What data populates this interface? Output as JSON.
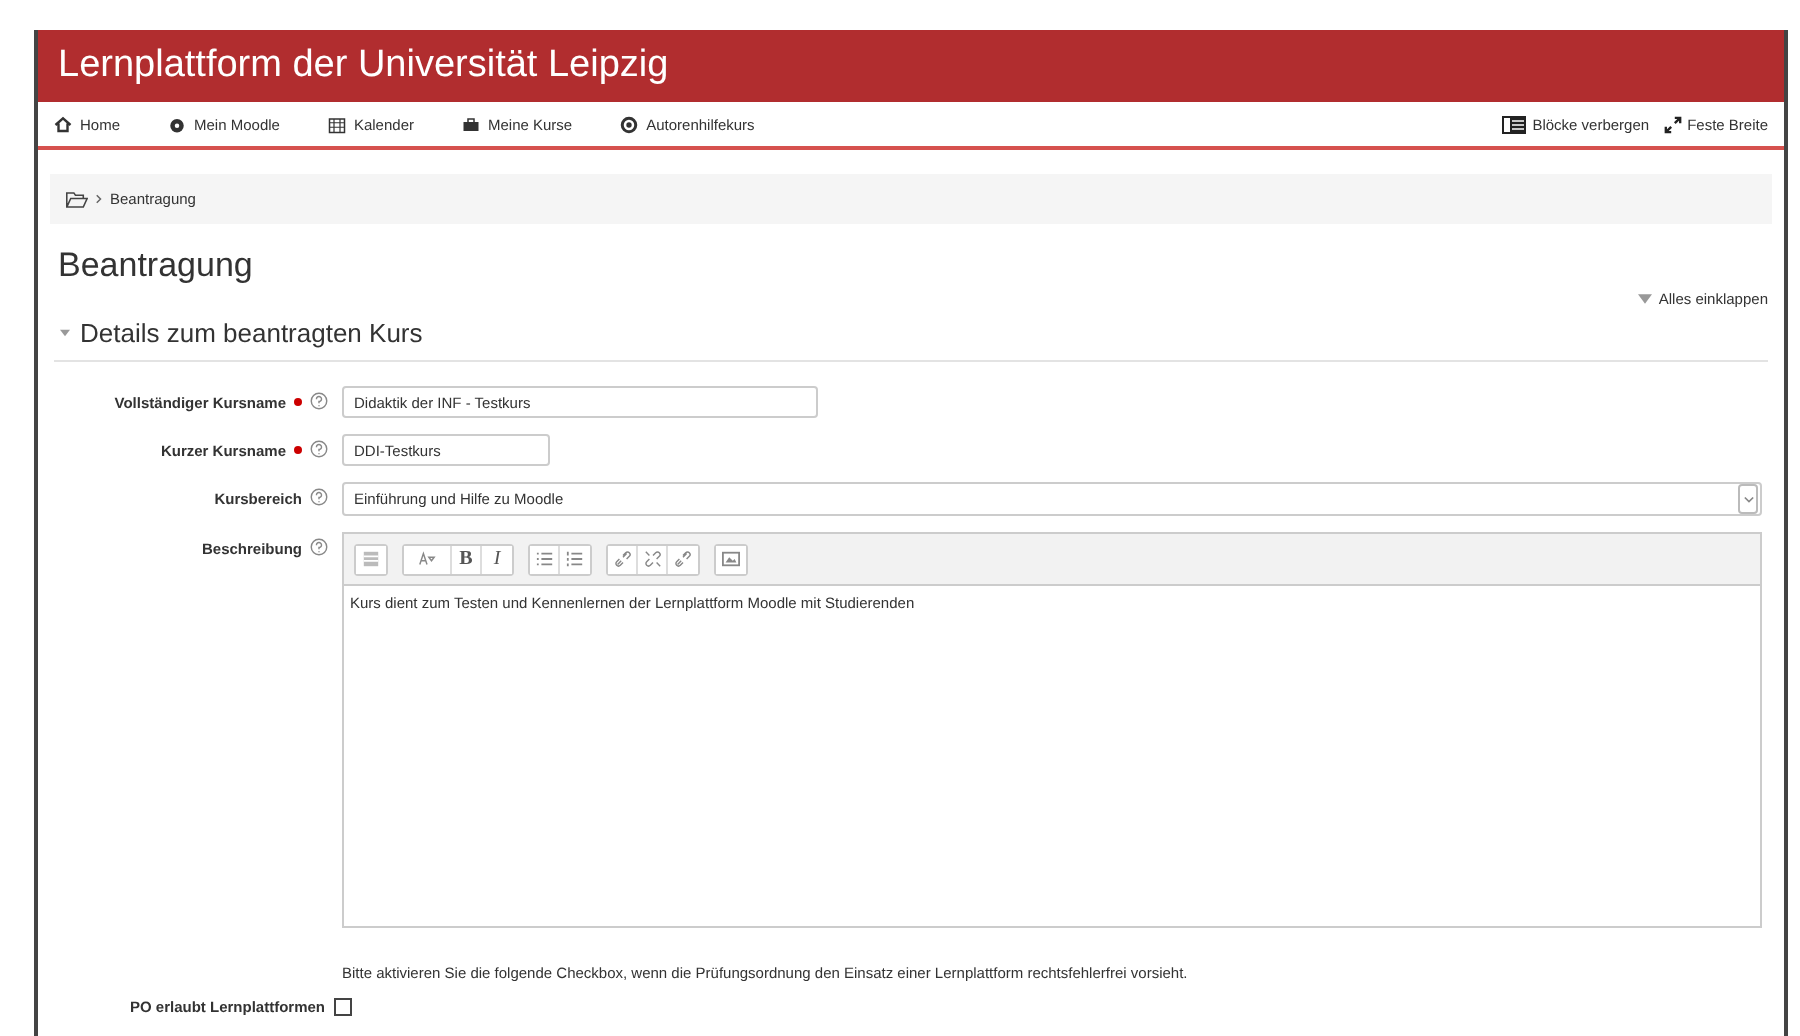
{
  "header": {
    "title": "Lernplattform der Universität Leipzig"
  },
  "nav": {
    "items": [
      "Home",
      "Mein Moodle",
      "Kalender",
      "Meine Kurse",
      "Autorenhilfekurs"
    ],
    "right": [
      "Blöcke verbergen",
      "Feste Breite"
    ]
  },
  "breadcrumb": [
    "Beantragung"
  ],
  "page_title": "Beantragung",
  "collapse_all": "Alles einklappen",
  "section": {
    "title": "Details zum beantragten Kurs",
    "expanded": true
  },
  "fields": [
    {
      "kind": "text",
      "label": "Vollständiger Kursname",
      "required": true,
      "value": "Didaktik der INF - Testkurs"
    },
    {
      "kind": "text",
      "label": "Kurzer Kursname",
      "required": true,
      "value": "DDI-Testkurs"
    },
    {
      "kind": "select",
      "label": "Kursbereich",
      "required": false,
      "value": "Einführung und Hilfe zu Moodle"
    },
    {
      "kind": "editor",
      "label": "Beschreibung",
      "required": false,
      "value": "Kurs dient zum Testen und Kennenlernen der Lernplattform Moodle mit Studierenden",
      "toolbar": [
        [
          {
            "kind": "toggle"
          }
        ],
        [
          {
            "kind": "style"
          },
          {
            "kind": "text",
            "label": "B"
          },
          {
            "kind": "text",
            "label": "I"
          }
        ],
        [
          {
            "kind": "bullets"
          },
          {
            "kind": "numbers"
          }
        ],
        [
          {
            "kind": "link"
          },
          {
            "kind": "unlink"
          },
          {
            "kind": "link"
          }
        ],
        [
          {
            "kind": "image"
          }
        ]
      ]
    }
  ],
  "hint": "Bitte aktivieren Sie die folgende Checkbox, wenn die Prüfungsordnung den Einsatz einer Lernplattform rechtsfehlerfrei vorsieht.",
  "checkbox": {
    "label": "PO erlaubt Lernplattformen",
    "checked": false
  }
}
